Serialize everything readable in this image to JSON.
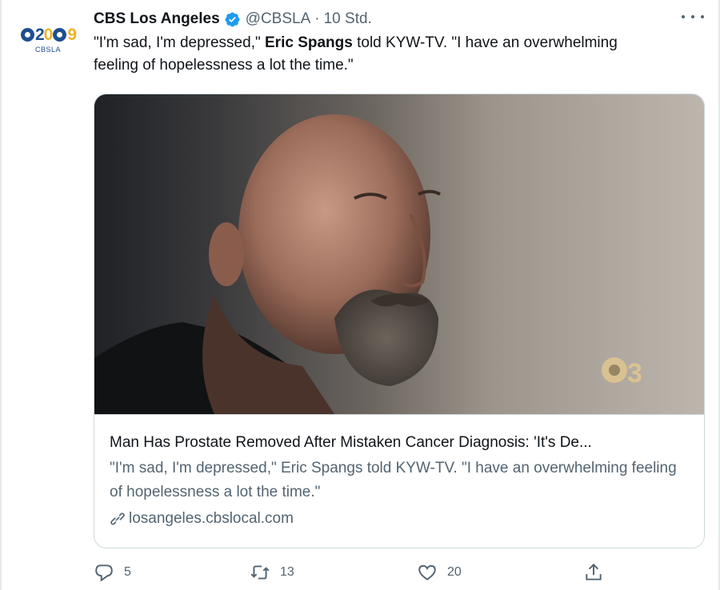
{
  "tweet": {
    "avatar": {
      "logo_digits": [
        "2",
        "0",
        "9"
      ],
      "logo_sub": "CBSLA"
    },
    "display_name": "CBS Los Angeles",
    "handle": "@CBSLA",
    "separator": "·",
    "time": "10 Std.",
    "text_before": "\"I'm sad, I'm depressed,\" ",
    "text_bold": "Eric Spangs",
    "text_after": " told KYW-TV. \"I have an overwhelming feeling of hopelessness a lot the time.\"",
    "card": {
      "title": "Man Has Prostate Removed After Mistaken Cancer Diagnosis: 'It's De...",
      "description": "\"I'm sad, I'm depressed,\" Eric Spangs told KYW-TV. \"I have an overwhelming feeling of hopelessness a lot the time.\"",
      "domain": "losangeles.cbslocal.com",
      "image_watermark": "3"
    },
    "actions": {
      "reply_count": "5",
      "retweet_count": "13",
      "like_count": "20"
    }
  },
  "colors": {
    "text": "#0f1419",
    "secondary": "#536471",
    "verified": "#1d9bf0",
    "border": "#cfd9de"
  },
  "icons": [
    "verified-badge-icon",
    "more-icon",
    "link-icon",
    "reply-icon",
    "retweet-icon",
    "like-icon",
    "share-icon"
  ]
}
